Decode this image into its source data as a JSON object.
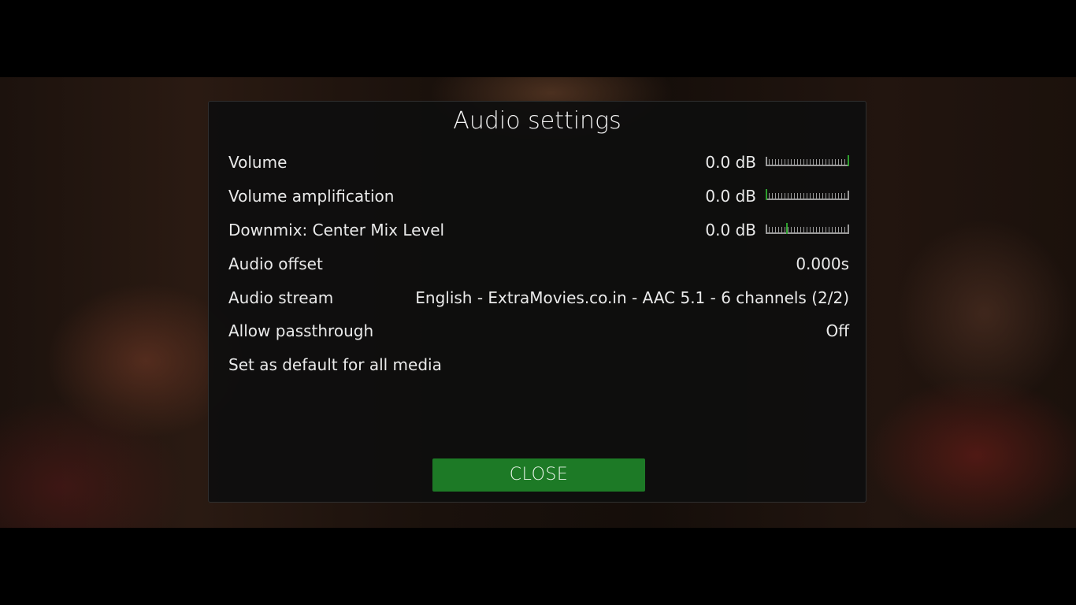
{
  "dialog": {
    "title": "Audio settings",
    "close_label": "CLOSE",
    "accent_color": "#1d7a26"
  },
  "settings": {
    "volume": {
      "label": "Volume",
      "value": "0.0 dB",
      "slider_level": 1.0
    },
    "volume_amplification": {
      "label": "Volume amplification",
      "value": "0.0 dB",
      "slider_level": 0.0
    },
    "center_mix": {
      "label": "Downmix: Center Mix Level",
      "value": "0.0 dB",
      "slider_level": 0.25
    },
    "audio_offset": {
      "label": "Audio offset",
      "value": "0.000s"
    },
    "audio_stream": {
      "label": "Audio stream",
      "value": "English - ExtraMovies.co.in - AAC 5.1 - 6 channels (2/2)"
    },
    "passthrough": {
      "label": "Allow passthrough",
      "value": "Off"
    },
    "set_default": {
      "label": "Set as default for all media"
    }
  }
}
